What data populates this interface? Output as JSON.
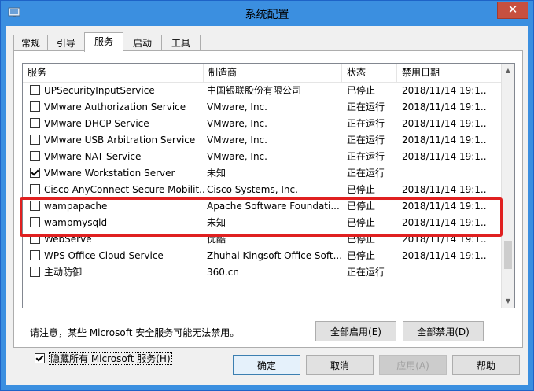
{
  "window": {
    "title": "系统配置",
    "close_label": "✕"
  },
  "tabs": [
    {
      "label": "常规",
      "active": false
    },
    {
      "label": "引导",
      "active": false
    },
    {
      "label": "服务",
      "active": true
    },
    {
      "label": "启动",
      "active": false
    },
    {
      "label": "工具",
      "active": false
    }
  ],
  "table": {
    "headers": [
      "服务",
      "制造商",
      "状态",
      "禁用日期"
    ],
    "rows": [
      {
        "checked": false,
        "name": "UPSecurityInputService",
        "vendor": "中国银联股份有限公司",
        "status": "已停止",
        "date": "2018/11/14 19:1..."
      },
      {
        "checked": false,
        "name": "VMware Authorization Service",
        "vendor": "VMware, Inc.",
        "status": "正在运行",
        "date": "2018/11/14 19:1..."
      },
      {
        "checked": false,
        "name": "VMware DHCP Service",
        "vendor": "VMware, Inc.",
        "status": "正在运行",
        "date": "2018/11/14 19:1..."
      },
      {
        "checked": false,
        "name": "VMware USB Arbitration Service",
        "vendor": "VMware, Inc.",
        "status": "正在运行",
        "date": "2018/11/14 19:1..."
      },
      {
        "checked": false,
        "name": "VMware NAT Service",
        "vendor": "VMware, Inc.",
        "status": "正在运行",
        "date": "2018/11/14 19:1..."
      },
      {
        "checked": true,
        "name": "VMware Workstation Server",
        "vendor": "未知",
        "status": "正在运行",
        "date": ""
      },
      {
        "checked": false,
        "name": "Cisco AnyConnect Secure Mobilit...",
        "vendor": "Cisco Systems, Inc.",
        "status": "已停止",
        "date": "2018/11/14 19:1..."
      },
      {
        "checked": false,
        "name": "wampapache",
        "vendor": "Apache Software Foundati...",
        "status": "已停止",
        "date": "2018/11/14 19:1..."
      },
      {
        "checked": false,
        "name": "wampmysqld",
        "vendor": "未知",
        "status": "已停止",
        "date": "2018/11/14 19:1..."
      },
      {
        "checked": false,
        "name": "WebServe",
        "vendor": "优酷",
        "status": "已停止",
        "date": "2018/11/14 19:1..."
      },
      {
        "checked": false,
        "name": "WPS Office Cloud Service",
        "vendor": "Zhuhai Kingsoft Office Soft...",
        "status": "已停止",
        "date": "2018/11/14 19:1..."
      },
      {
        "checked": false,
        "name": "主动防御",
        "vendor": "360.cn",
        "status": "正在运行",
        "date": ""
      }
    ]
  },
  "notice": "请注意，某些 Microsoft 安全服务可能无法禁用。",
  "buttons": {
    "enable_all": "全部启用(E)",
    "disable_all": "全部禁用(D)",
    "ok": "确定",
    "cancel": "取消",
    "apply": "应用(A)",
    "help": "帮助"
  },
  "hide_ms": {
    "checked": true,
    "label": "隐藏所有 Microsoft 服务(H)"
  },
  "colors": {
    "titlebar": "#3b8fe0",
    "close": "#c7503f",
    "highlight": "#e02020"
  }
}
